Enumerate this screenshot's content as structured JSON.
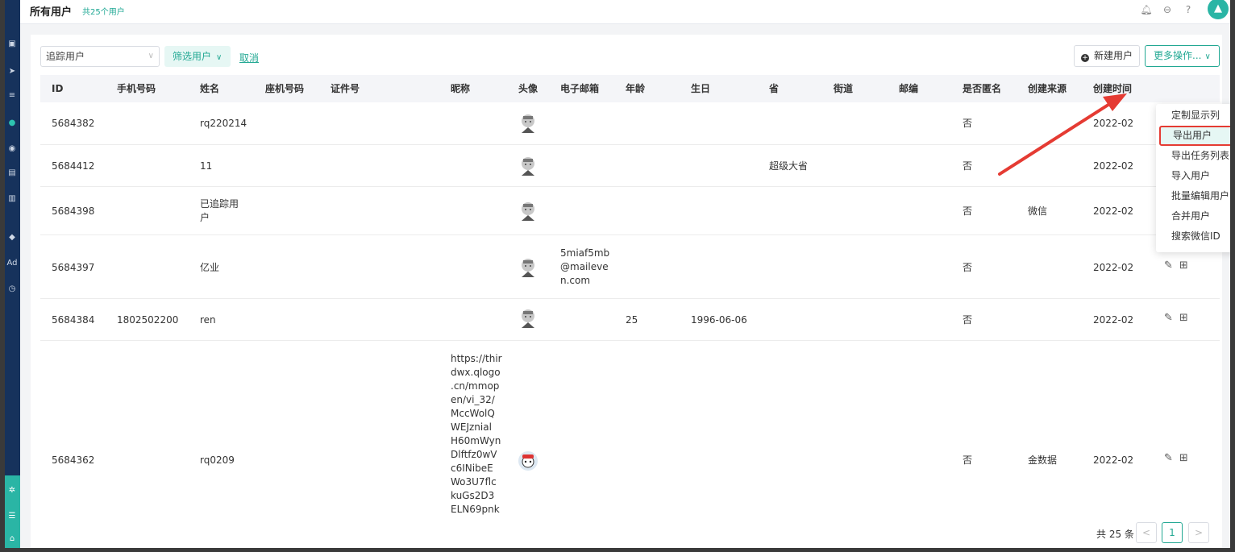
{
  "header": {
    "title": "所有用户",
    "count": "共25个用户"
  },
  "toolbar": {
    "select_value": "追踪用户",
    "filter_label": "筛选用户",
    "cancel_label": "取消",
    "new_user_label": "新建用户",
    "more_label": "更多操作..."
  },
  "columns": [
    "ID",
    "手机号码",
    "姓名",
    "座机号码",
    "证件号",
    "昵称",
    "头像",
    "电子邮箱",
    "年龄",
    "生日",
    "省",
    "街道",
    "邮编",
    "是否匿名",
    "创建来源",
    "创建时间"
  ],
  "rows": [
    {
      "id": "5684382",
      "phone": "",
      "name": "rq220214",
      "nickname": "",
      "email": "",
      "age": "",
      "birthday": "",
      "province": "",
      "anonymous": "否",
      "source": "",
      "created": "2022-02"
    },
    {
      "id": "5684412",
      "phone": "",
      "name": "11",
      "nickname": "",
      "email": "",
      "age": "",
      "birthday": "",
      "province": "超级大省",
      "anonymous": "否",
      "source": "",
      "created": "2022-02"
    },
    {
      "id": "5684398",
      "phone": "",
      "name": "已追踪用户",
      "nickname": "",
      "email": "",
      "age": "",
      "birthday": "",
      "province": "",
      "anonymous": "否",
      "source": "微信",
      "created": "2022-02"
    },
    {
      "id": "5684397",
      "phone": "",
      "name": "亿业",
      "nickname": "",
      "email": "5miaf5mb@maileven.com",
      "age": "",
      "birthday": "",
      "province": "",
      "anonymous": "否",
      "source": "",
      "created": "2022-02"
    },
    {
      "id": "5684384",
      "phone": "1802502200",
      "name": "ren",
      "nickname": "",
      "email": "",
      "age": "25",
      "birthday": "1996-06-06",
      "province": "",
      "anonymous": "否",
      "source": "",
      "created": "2022-02"
    },
    {
      "id": "5684362",
      "phone": "",
      "name": "rq0209",
      "nickname": "https://thirdwx.qlogo.cn/mmopen/vi_32/MccWolQWEJznialH60mWynDlftfz0wVc6INibeEWo3U7flckuGs2D3ELN69pnk",
      "email": "",
      "age": "",
      "birthday": "",
      "province": "",
      "anonymous": "否",
      "source": "金数据",
      "created": "2022-02"
    }
  ],
  "name_wrap": {
    "row2_line1": "已追踪用",
    "row2_line2": "户"
  },
  "email_wrap": [
    "5miaf5mb",
    "@maileve",
    "n.com"
  ],
  "nickname_wrap": [
    "https://thir",
    "dwx.qlogo",
    ".cn/mmop",
    "en/vi_32/",
    "MccWolQ",
    "WEJznial",
    "H60mWyn",
    "Dlftfz0wV",
    "c6INibeE",
    "Wo3U7flc",
    "kuGs2D3",
    "ELN69pnk"
  ],
  "dropdown": {
    "items": [
      "定制显示列",
      "导出用户",
      "导出任务列表",
      "导入用户",
      "批量编辑用户",
      "合并用户",
      "搜索微信ID"
    ]
  },
  "pagination": {
    "total": "共 25 条",
    "prev": "<",
    "current": "1",
    "next": ">"
  },
  "colors": {
    "accent": "#22a893",
    "highlight_border": "#e53b33",
    "rail": "#16325c"
  }
}
